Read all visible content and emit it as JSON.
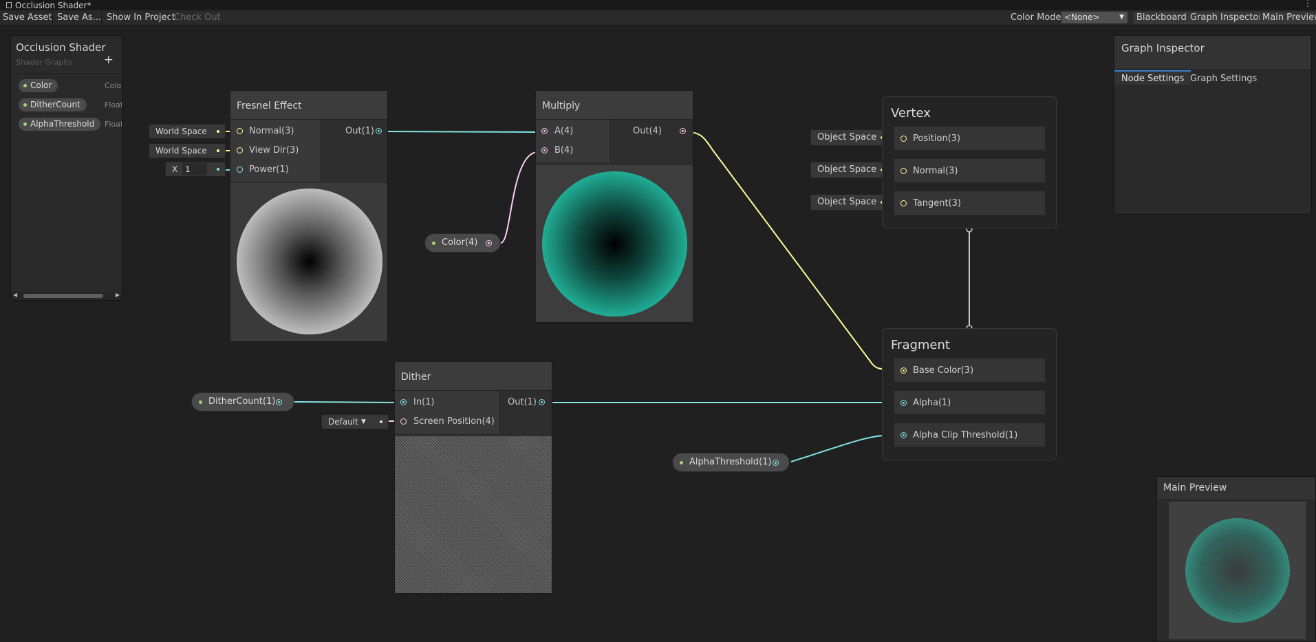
{
  "window": {
    "title": "Occlusion Shader*"
  },
  "toolbar": {
    "save_asset": "Save Asset",
    "save_as": "Save As...",
    "show_in_project": "Show In Project",
    "check_out": "Check Out",
    "color_mode_label": "Color Mode",
    "color_mode_value": "<None>",
    "blackboard": "Blackboard",
    "graph_inspector": "Graph Inspector",
    "main_preview": "Main Preview"
  },
  "blackboard": {
    "title": "Occlusion Shader",
    "subtitle": "Shader Graphs",
    "add": "+",
    "properties": [
      {
        "name": "Color",
        "type": "Color"
      },
      {
        "name": "DitherCount",
        "type": "Float"
      },
      {
        "name": "AlphaThreshold",
        "type": "Float"
      }
    ]
  },
  "nodes": {
    "fresnel": {
      "title": "Fresnel Effect",
      "inputs": [
        "Normal(3)",
        "View Dir(3)",
        "Power(1)"
      ],
      "output": "Out(1)",
      "inline": {
        "normal": "World Space",
        "view_dir": "World Space",
        "power_axis": "X",
        "power_value": "1"
      }
    },
    "multiply": {
      "title": "Multiply",
      "inputs": [
        "A(4)",
        "B(4)"
      ],
      "output": "Out(4)"
    },
    "dither": {
      "title": "Dither",
      "inputs": [
        "In(1)",
        "Screen Position(4)"
      ],
      "output": "Out(1)",
      "inline": {
        "screen_position": "Default"
      }
    },
    "color_prop": {
      "label": "Color(4)"
    },
    "dither_count_prop": {
      "label": "DitherCount(1)"
    },
    "alpha_threshold_prop": {
      "label": "AlphaThreshold(1)"
    }
  },
  "master": {
    "vertex": {
      "title": "Vertex",
      "slots": [
        "Position(3)",
        "Normal(3)",
        "Tangent(3)"
      ],
      "spaces": [
        "Object Space",
        "Object Space",
        "Object Space"
      ]
    },
    "fragment": {
      "title": "Fragment",
      "slots": [
        "Base Color(3)",
        "Alpha(1)",
        "Alpha Clip Threshold(1)"
      ]
    }
  },
  "graph_inspector": {
    "title": "Graph Inspector",
    "tabs": [
      "Node Settings",
      "Graph Settings"
    ],
    "active_tab": "Node Settings"
  },
  "main_preview": {
    "title": "Main Preview"
  },
  "colors": {
    "vector1": "#84e4e7",
    "vector3": "#f6ff9a",
    "vector4": "#fbcbf4",
    "property_dot": "#9fd572",
    "accent": "#3b80cb"
  }
}
